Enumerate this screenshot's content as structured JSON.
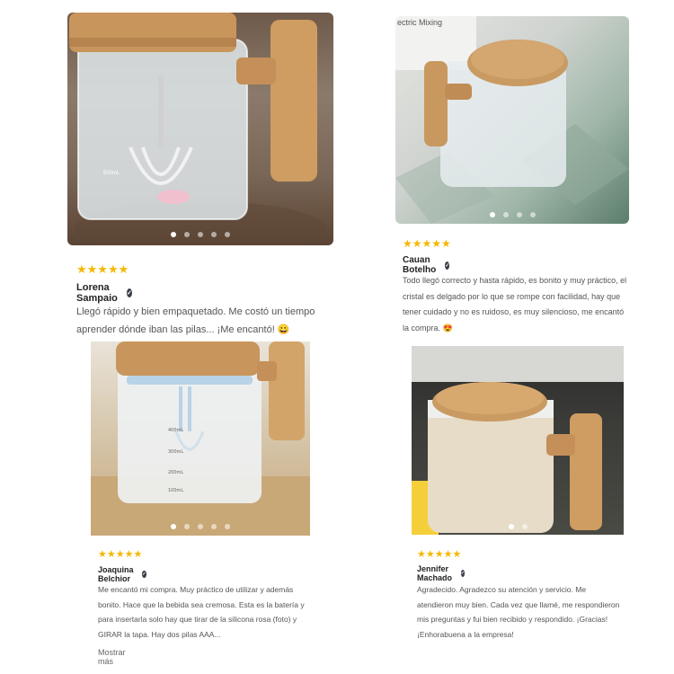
{
  "reviews": [
    {
      "stars": "★★★★★",
      "name": "Lorena Sampaio",
      "text": "Llegó rápido y bien empaquetado. Me costó un tiempo aprender dónde iban las pilas... ¡Me encantó! 😀",
      "photo_dots": 5,
      "active_dot": 0,
      "photo_text": "600mL"
    },
    {
      "stars": "★★★★★",
      "name": "Cauan Botelho",
      "text": "Todo llegó correcto y hasta rápido, es bonito y muy práctico, el cristal es delgado por lo que se rompe con facilidad, hay que tener cuidado y no es ruidoso, es muy silencioso, me encantó la compra. 😍",
      "photo_dots": 4,
      "active_dot": 0,
      "photo_text": "ectric Mixing"
    },
    {
      "stars": "★★★★★",
      "name": "Joaquina Belchior",
      "text": "Me encantó mi compra. Muy práctico de utilizar y además bonito. Hace que la bebida sea cremosa. Esta es la batería y para insertarla solo hay que tirar de la silicona rosa (foto) y GIRAR la tapa. Hay dos pilas AAA...",
      "more_label": "Mostrar más",
      "photo_dots": 5,
      "active_dot": 0,
      "scale_labels": [
        "400mL",
        "300mL",
        "200mL",
        "100mL"
      ]
    },
    {
      "stars": "★★★★★",
      "name": "Jennifer Machado",
      "text": "Agradecido. Agradezco su atención y servicio. Me atendieron muy bien. Cada vez que llamé, me respondieron mis preguntas y fui bien recibido y respondido. ¡Gracias! ¡Enhorabuena a la empresa!",
      "photo_dots": 2,
      "active_dot": 0
    }
  ],
  "colors": {
    "star": "#f5b800",
    "verified_badge": "#3b3f4a",
    "wood": "#c8955c",
    "glass": "#e8eef0"
  },
  "icons": {
    "star": "star-icon",
    "verified": "verified-check-icon",
    "carousel_dot": "carousel-dot"
  }
}
